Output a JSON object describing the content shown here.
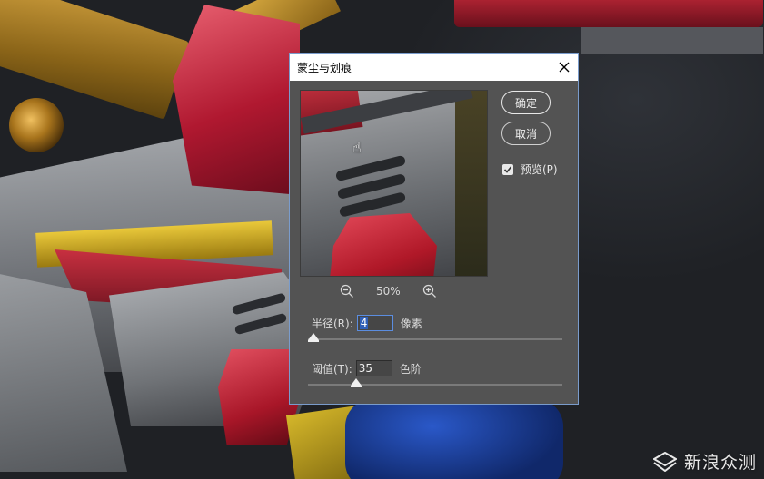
{
  "dialog": {
    "title": "蒙尘与划痕",
    "ok_label": "确定",
    "cancel_label": "取消",
    "preview_label": "预览(P)",
    "preview_checked": true,
    "zoom_level": "50%",
    "radius": {
      "label": "半径(R):",
      "value": "4",
      "unit": "像素",
      "slider_fraction": 0.02
    },
    "threshold": {
      "label": "阈值(T):",
      "value": "35",
      "unit": "色阶",
      "slider_fraction": 0.19
    }
  },
  "icons": {
    "close": "close-icon",
    "zoom_out": "zoom-out-icon",
    "zoom_in": "zoom-in-icon",
    "hand": "hand-cursor-icon",
    "check": "checkmark-icon",
    "slider": "triangle-slider-icon",
    "watermark": "sina-logo-icon"
  },
  "watermark": {
    "text": "新浪众测"
  },
  "colors": {
    "accent": "#5b8de0",
    "dialog_bg": "#535353",
    "selection": "#2f5fb8"
  }
}
